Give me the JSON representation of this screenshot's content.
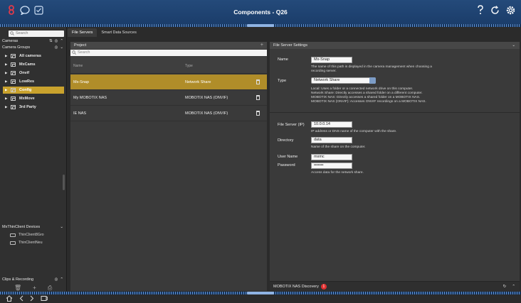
{
  "window": {
    "title": "Components - Q26",
    "colors": {
      "titlebar": "#1f4474",
      "accent": "#c9a22d",
      "alert": "#e03030"
    }
  },
  "sidebar": {
    "search_placeholder": "Search",
    "cameras_label": "Cameras",
    "camera_groups_label": "Camera Groups",
    "groups": [
      {
        "label": "All cameras",
        "selected": false
      },
      {
        "label": "MxCams",
        "selected": false
      },
      {
        "label": "Onvif",
        "selected": false
      },
      {
        "label": "LowRes",
        "selected": false
      },
      {
        "label": "Config",
        "selected": true
      },
      {
        "label": "MxMove",
        "selected": false
      },
      {
        "label": "3rd Party",
        "selected": false
      }
    ],
    "devices_label": "MxThinClient Devices",
    "devices": [
      "ThinClient8Gro",
      "ThinClientNeu"
    ],
    "clips_label": "Clips & Recording"
  },
  "tabs": [
    {
      "label": "File Servers",
      "active": true
    },
    {
      "label": "Smart Data Sources",
      "active": false
    }
  ],
  "project": {
    "header": "Project",
    "search_placeholder": "Search",
    "columns": [
      "Name",
      "Type"
    ],
    "rows": [
      {
        "name": "Mx-Snap",
        "type": "Network Share",
        "selected": true
      },
      {
        "name": "My MOBOTIX NAS",
        "type": "MOBOTIX NAS (ONVIF)",
        "selected": false
      },
      {
        "name": "IE NAS",
        "type": "MOBOTIX NAS (ONVIF)",
        "selected": false
      }
    ]
  },
  "settings": {
    "header": "File Server Settings",
    "name_label": "Name",
    "name_value": "Mx-Snap",
    "name_help": "The name of this path is displayed in the camera management when choosing a recording server.",
    "type_label": "Type",
    "type_value": "Network Share",
    "type_help_1": "Local: Uses a folder or a connected network drive on this computer.",
    "type_help_2": "Network Share: Directly accesses a shared folder on a different computer.",
    "type_help_3": "MOBOTIX NAS: Directly accesses a shared folder on a MOBOTIX NAS.",
    "type_help_4": "MOBOTIX NAS (ONVIF): Accesses ONVIF recordings on a MOBOTIX NAS.",
    "server_label": "File Server (IP)",
    "server_value": "10.0.0.14",
    "server_help": "IP address or DNS name of the computer with the share.",
    "dir_label": "Directory",
    "dir_value": "data",
    "dir_help": "Name of the share on the computer.",
    "user_label": "User Name",
    "user_value": "mxmc",
    "pass_label": "Password",
    "pass_value": "•••••••",
    "pass_help": "Access data for the network share."
  },
  "discovery": {
    "label": "MOBOTIX NAS Discovery",
    "count": "1"
  },
  "icons": [
    "logo-icon",
    "chat-icon",
    "checkbox-icon",
    "help-icon",
    "refresh-icon",
    "settings-icon",
    "search-icon",
    "plus-icon",
    "trash-icon",
    "monitor-icon",
    "home-icon",
    "back-icon",
    "forward-icon",
    "screen-icon"
  ]
}
